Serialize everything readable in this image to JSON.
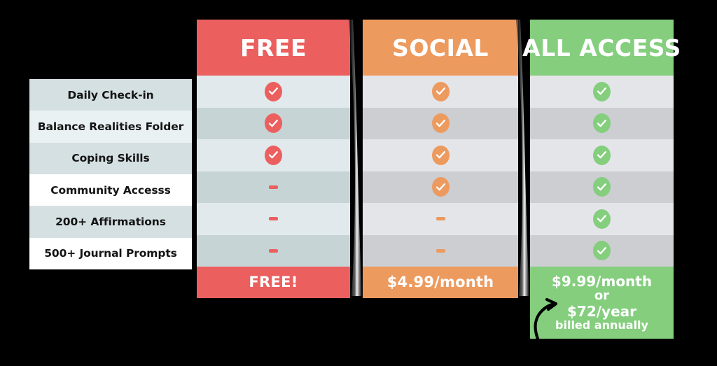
{
  "features": {
    "items": [
      {
        "label": "Daily Check-in"
      },
      {
        "label": "Balance Realities Folder"
      },
      {
        "label": "Coping Skills"
      },
      {
        "label": "Community Accesss"
      },
      {
        "label": "200+ Affirmations"
      },
      {
        "label": "500+ Journal Prompts"
      }
    ]
  },
  "plans": [
    {
      "id": "free",
      "title": "FREE",
      "color": "#eb5f5f",
      "cells": [
        "check",
        "check",
        "check",
        "dash",
        "dash",
        "dash"
      ],
      "price_line_1": "FREE!"
    },
    {
      "id": "social",
      "title": "SOCIAL",
      "color": "#ed9a5f",
      "cells": [
        "check",
        "check",
        "check",
        "check",
        "dash",
        "dash"
      ],
      "price_line_1": "$4.99/month"
    },
    {
      "id": "all",
      "title": "ALL ACCESS",
      "color": "#84ce7e",
      "cells": [
        "check",
        "check",
        "check",
        "check",
        "check",
        "check"
      ],
      "price_line_1": "$9.99/month",
      "price_line_2": "or",
      "price_line_3": "$72/year",
      "price_note": "billed annually"
    }
  ],
  "icons": {
    "check": "check-icon",
    "dash": "dash-icon",
    "arrow": "curved-arrow-icon"
  }
}
